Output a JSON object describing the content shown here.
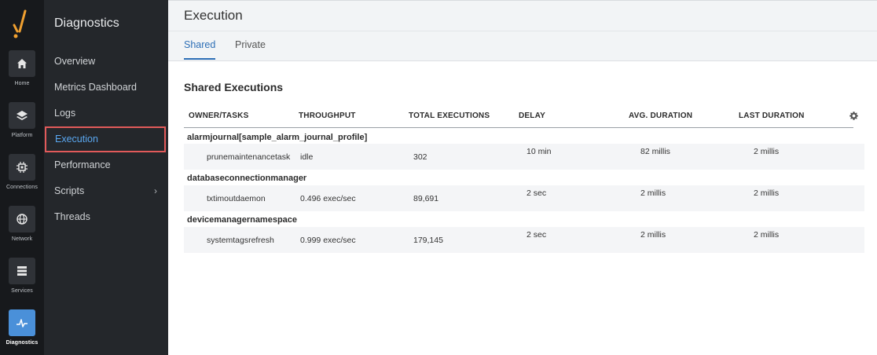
{
  "rail": {
    "items": [
      {
        "label": "Home",
        "icon": "home-icon"
      },
      {
        "label": "Platform",
        "icon": "layers-icon"
      },
      {
        "label": "Connections",
        "icon": "chip-icon"
      },
      {
        "label": "Network",
        "icon": "globe-icon"
      },
      {
        "label": "Services",
        "icon": "server-icon"
      },
      {
        "label": "Diagnostics",
        "icon": "pulse-icon",
        "active": true
      }
    ],
    "colors": {
      "background": "#17191c",
      "active": "#4a90d9"
    }
  },
  "nav": {
    "title": "Diagnostics",
    "items": [
      {
        "label": "Overview"
      },
      {
        "label": "Metrics Dashboard"
      },
      {
        "label": "Logs"
      },
      {
        "label": "Execution",
        "active": true
      },
      {
        "label": "Performance"
      },
      {
        "label": "Scripts",
        "has_submenu": true
      },
      {
        "label": "Threads"
      }
    ]
  },
  "header": {
    "title": "Execution",
    "tabs": [
      {
        "label": "Shared",
        "active": true
      },
      {
        "label": "Private"
      }
    ]
  },
  "section": {
    "title": "Shared Executions"
  },
  "table": {
    "columns": [
      "OWNER/TASKS",
      "THROUGHPUT",
      "TOTAL EXECUTIONS",
      "DELAY",
      "AVG. DURATION",
      "LAST DURATION"
    ],
    "groups": [
      {
        "owner": "alarmjournal[sample_alarm_journal_profile]",
        "task": {
          "name": "prunemaintenancetask",
          "throughput": "idle",
          "total": "302",
          "delay": "10 min",
          "avg": "82 millis",
          "last": "2 millis"
        }
      },
      {
        "owner": "databaseconnectionmanager",
        "task": {
          "name": "txtimoutdaemon",
          "throughput": "0.496 exec/sec",
          "total": "89,691",
          "delay": "2 sec",
          "avg": "2 millis",
          "last": "2 millis"
        }
      },
      {
        "owner": "devicemanagernamespace",
        "task": {
          "name": "systemtagsrefresh",
          "throughput": "0.999 exec/sec",
          "total": "179,145",
          "delay": "2 sec",
          "avg": "2 millis",
          "last": "2 millis"
        }
      }
    ]
  },
  "accent": "#2e6fb6"
}
